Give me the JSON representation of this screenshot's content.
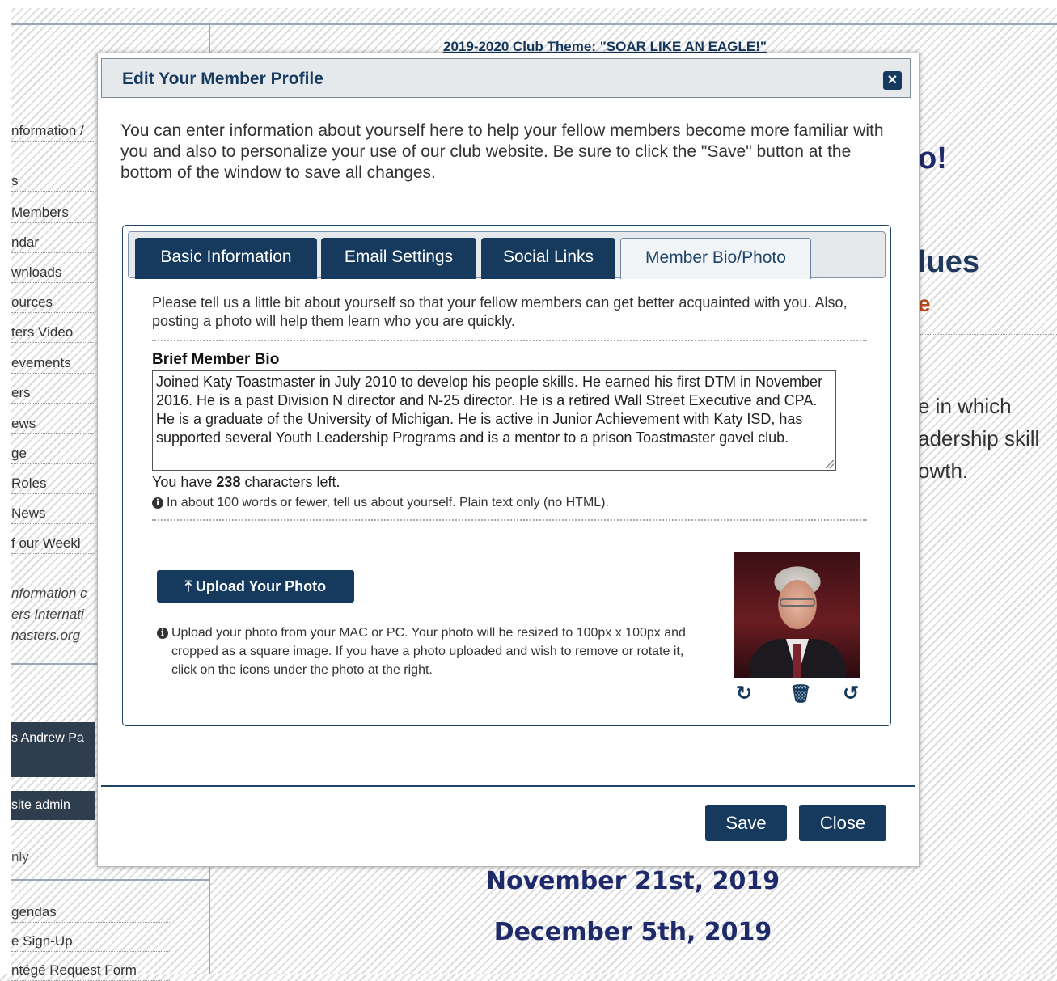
{
  "header": {
    "theme_text": "2019-2020 Club Theme: \"SOAR LIKE AN EAGLE!\""
  },
  "sidebar": {
    "items": [
      "nformation /",
      "s",
      "Members",
      "ndar",
      "wnloads",
      "ources",
      "ters Video",
      "evements",
      "ers",
      "ews",
      "ge",
      "Roles",
      "News",
      "f our Weekl"
    ],
    "italic_lines": [
      "nformation c",
      "ers Internati"
    ],
    "italic_link": "nasters.org",
    "dark_buttons": [
      "s Andrew Pa",
      "site admin"
    ],
    "only_text": "nly",
    "bottom_items": [
      "gendas",
      "e Sign-Up",
      "ntégé Request Form"
    ]
  },
  "background": {
    "heading_fragment": "o!",
    "values_fragment": "lues",
    "red_fragment": "e",
    "text_lines": [
      "e in which",
      "adership skill",
      "owth."
    ],
    "dates": [
      "November 21st, 2019",
      "December 5th, 2019"
    ]
  },
  "colors": {
    "brand": "#153a5e",
    "date_blue": "#1f2a6b",
    "red_accent": "#b94a1c"
  },
  "modal": {
    "title": "Edit Your Member Profile",
    "close_icon": "close-icon",
    "intro": "You can enter information about yourself here to help your fellow members become more familiar with you and also to personalize your use of our club website. Be sure to click the \"Save\" button at the bottom of the window to save all changes.",
    "tabs": [
      {
        "label": "Basic Information",
        "active": false
      },
      {
        "label": "Email Settings",
        "active": false
      },
      {
        "label": "Social Links",
        "active": false
      },
      {
        "label": "Member Bio/Photo",
        "active": true
      }
    ],
    "help_text": "Please tell us a little bit about yourself so that your fellow members can get better acquainted with you. Also, posting a photo will help them learn who you are quickly.",
    "bio_label": "Brief Member Bio",
    "bio_value": "Joined Katy Toastmaster in July 2010 to develop his people skills. He earned his first DTM in November 2016.  He is a past Division N director and N-25 director.   He is a retired Wall Street Executive and CPA. He is a graduate of the University of Michigan. He is active in Junior Achievement with Katy ISD, has supported several Youth Leadership Programs and is a mentor to a prison Toastmaster gavel club.",
    "chars_prefix": "You have ",
    "chars_count": "238",
    "chars_suffix": " characters left.",
    "bio_note": "In about 100 words or fewer, tell us about yourself. Plain text only (no HTML).",
    "upload_label": "Upload Your Photo",
    "upload_note": "Upload your photo from your MAC or PC. Your photo will be resized to 100px x 100px and cropped as a square image. If you have a photo uploaded and wish to remove or rotate it, click on the icons under the photo at the right.",
    "photo_icons": [
      "rotate-right-icon",
      "trash-icon",
      "rotate-left-icon"
    ],
    "save_label": "Save",
    "close_label": "Close"
  }
}
